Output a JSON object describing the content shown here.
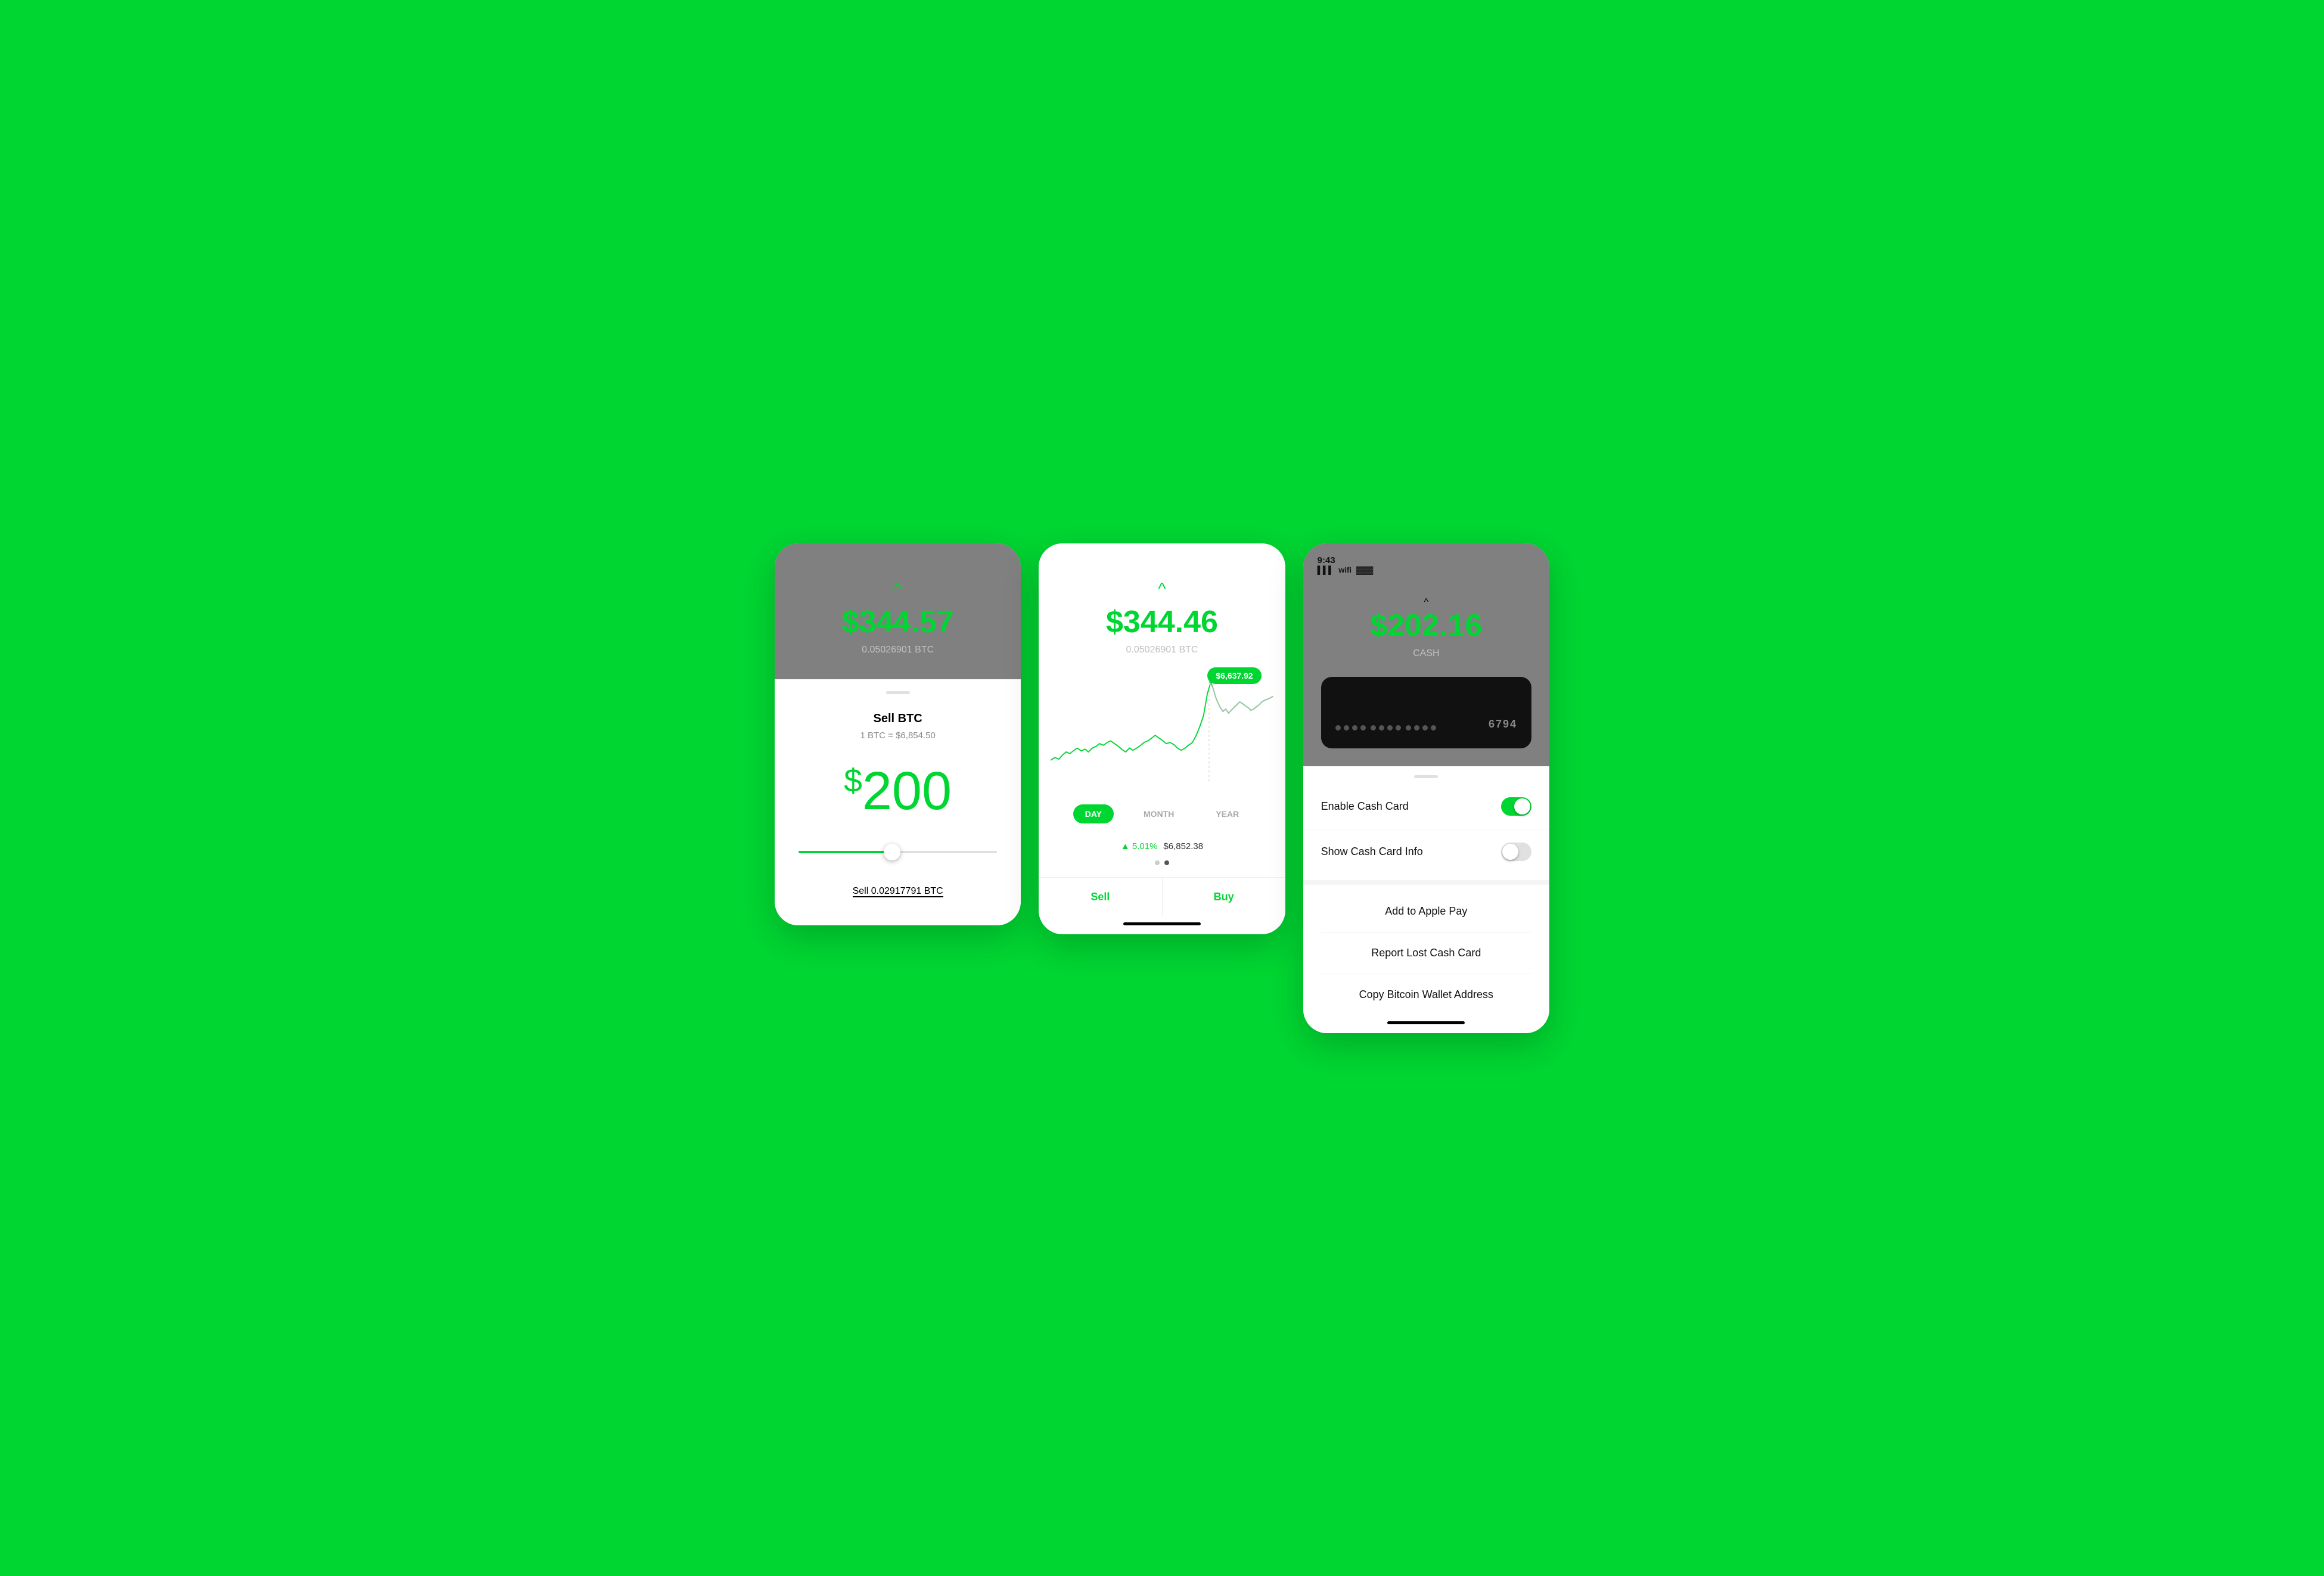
{
  "screen1": {
    "chevron": "^",
    "balance": "$344.57",
    "btc_sub": "0.05026901 BTC",
    "handle": "",
    "sell_title": "Sell BTC",
    "sell_rate": "1 BTC = $6,854.50",
    "sell_amount_dollar": "$",
    "sell_amount_number": "200",
    "sell_btc_label": "Sell 0.02917791 BTC"
  },
  "screen2": {
    "chevron": "^",
    "balance": "$344.46",
    "btc_sub": "0.05026901 BTC",
    "chart_tooltip": "$6,637.92",
    "time_buttons": [
      "DAY",
      "MONTH",
      "YEAR"
    ],
    "active_time": "DAY",
    "gain_pct": "▲ 5.01%",
    "gain_value": "$6,852.38",
    "sell_label": "Sell",
    "buy_label": "Buy"
  },
  "screen3": {
    "status_time": "9:43",
    "status_arrow": "✈",
    "card_number_end": "6794",
    "chevron": "^",
    "cash_amount": "$202.16",
    "cash_label": "CASH",
    "enable_label": "Enable Cash Card",
    "show_info_label": "Show Cash Card Info",
    "add_apple_pay_label": "Add to Apple Pay",
    "report_lost_label": "Report Lost Cash Card",
    "bitcoin_wallet_label": "Copy Bitcoin Wallet Address"
  },
  "colors": {
    "green": "#00d632",
    "gray_bg": "#808080",
    "white": "#ffffff",
    "dark_card": "#111111",
    "text_dark": "#111111",
    "text_muted": "#888888"
  }
}
